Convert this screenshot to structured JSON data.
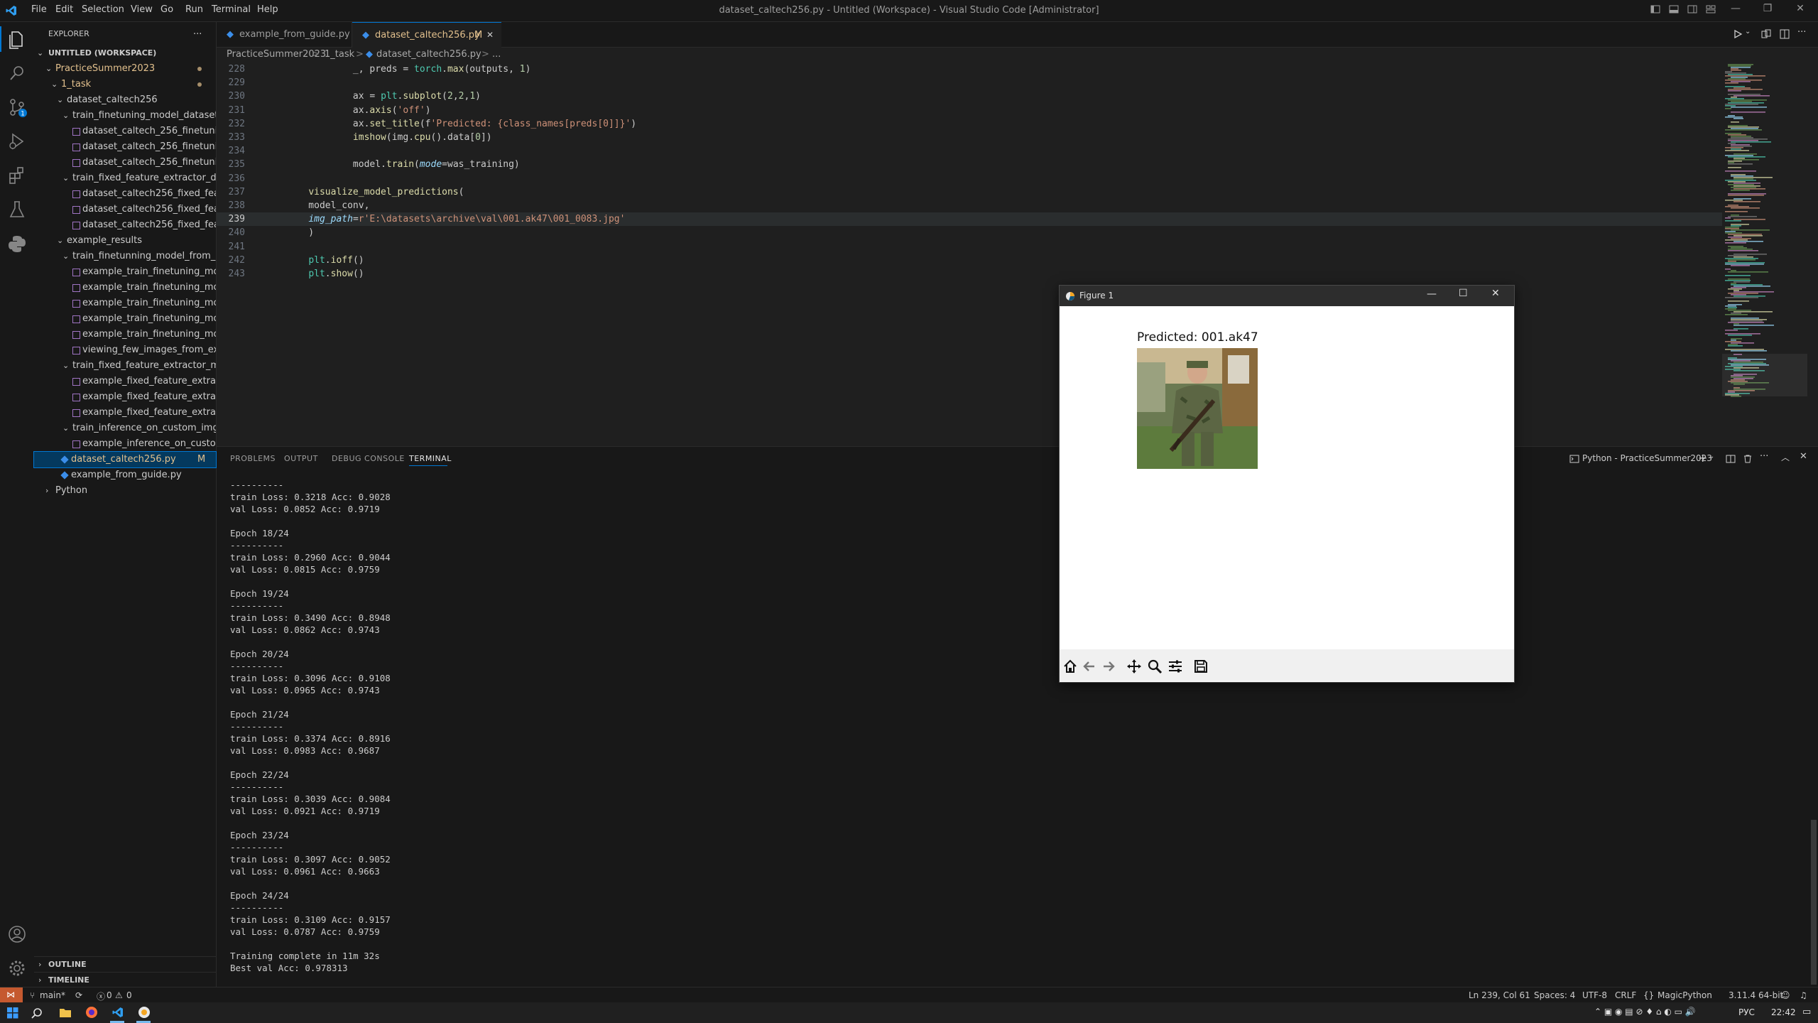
{
  "titlebar": {
    "menu": [
      "File",
      "Edit",
      "Selection",
      "View",
      "Go",
      "Run",
      "Terminal",
      "Help"
    ],
    "title": "dataset_caltech256.py - Untitled (Workspace) - Visual Studio Code [Administrator]"
  },
  "sidebar": {
    "header": "EXPLORER",
    "more": "...",
    "workspace": "UNTITLED (WORKSPACE)",
    "tree": [
      {
        "label": "PracticeSummer2023",
        "indent": 1,
        "type": "folder-open",
        "dot": true
      },
      {
        "label": "1_task",
        "indent": 2,
        "type": "folder-open",
        "dot": true
      },
      {
        "label": "dataset_caltech256",
        "indent": 3,
        "type": "folder-open"
      },
      {
        "label": "train_finetuning_model_dataset_...",
        "indent": 4,
        "type": "folder-open"
      },
      {
        "label": "dataset_caltech_256_finetunin...",
        "indent": 5,
        "type": "image"
      },
      {
        "label": "dataset_caltech_256_finetunin...",
        "indent": 5,
        "type": "image"
      },
      {
        "label": "dataset_caltech_256_finetunin...",
        "indent": 5,
        "type": "image"
      },
      {
        "label": "train_fixed_feature_extractor_dat...",
        "indent": 4,
        "type": "folder-open"
      },
      {
        "label": "dataset_caltech256_fixed_featu...",
        "indent": 5,
        "type": "image"
      },
      {
        "label": "dataset_caltech256_fixed_featu...",
        "indent": 5,
        "type": "image"
      },
      {
        "label": "dataset_caltech256_fixed_featu...",
        "indent": 5,
        "type": "image"
      },
      {
        "label": "example_results",
        "indent": 3,
        "type": "folder-open"
      },
      {
        "label": "train_finetunning_model_from_e...",
        "indent": 4,
        "type": "folder-open"
      },
      {
        "label": "example_train_finetuning_mod...",
        "indent": 5,
        "type": "image"
      },
      {
        "label": "example_train_finetuning_mod...",
        "indent": 5,
        "type": "image"
      },
      {
        "label": "example_train_finetuning_mod...",
        "indent": 5,
        "type": "image"
      },
      {
        "label": "example_train_finetuning_mod...",
        "indent": 5,
        "type": "image"
      },
      {
        "label": "example_train_finetuning_mod...",
        "indent": 5,
        "type": "image"
      },
      {
        "label": "viewing_few_images_from_exa...",
        "indent": 5,
        "type": "image"
      },
      {
        "label": "train_fixed_feature_extractor_mo...",
        "indent": 4,
        "type": "folder-open"
      },
      {
        "label": "example_fixed_feature_extracto...",
        "indent": 5,
        "type": "image"
      },
      {
        "label": "example_fixed_feature_extracto...",
        "indent": 5,
        "type": "image"
      },
      {
        "label": "example_fixed_feature_extracto...",
        "indent": 5,
        "type": "image"
      },
      {
        "label": "train_inference_on_custom_imgs...",
        "indent": 4,
        "type": "folder-open"
      },
      {
        "label": "example_inference_on_custom_...",
        "indent": 5,
        "type": "image"
      },
      {
        "label": "dataset_caltech256.py",
        "indent": 3,
        "type": "python",
        "selected": true,
        "badge": "M"
      },
      {
        "label": "example_from_guide.py",
        "indent": 3,
        "type": "python"
      },
      {
        "label": "Python",
        "indent": 1,
        "type": "folder-closed"
      }
    ],
    "outline": "OUTLINE",
    "timeline": "TIMELINE"
  },
  "tabs": [
    {
      "label": "example_from_guide.py",
      "active": false
    },
    {
      "label": "dataset_caltech256.py",
      "active": true,
      "badge": "M",
      "close": "✕"
    }
  ],
  "breadcrumb": [
    "PracticeSummer2023",
    "1_task",
    "dataset_caltech256.py",
    "..."
  ],
  "breadcrumb_sep": ">",
  "code": [
    {
      "n": "228",
      "text": "            _, preds = torch.max(outputs, 1)"
    },
    {
      "n": "229",
      "text": ""
    },
    {
      "n": "230",
      "text": "            ax = plt.subplot(2,2,1)"
    },
    {
      "n": "231",
      "text": "            ax.axis('off')"
    },
    {
      "n": "232",
      "text": "            ax.set_title(f'Predicted: {class_names[preds[0]]}')"
    },
    {
      "n": "233",
      "text": "            imshow(img.cpu().data[0])"
    },
    {
      "n": "234",
      "text": ""
    },
    {
      "n": "235",
      "text": "            model.train(mode=was_training)"
    },
    {
      "n": "236",
      "text": ""
    },
    {
      "n": "237",
      "text": "    visualize_model_predictions("
    },
    {
      "n": "238",
      "text": "    model_conv,"
    },
    {
      "n": "239",
      "text": "    img_path=r'E:\\datasets\\archive\\val\\001.ak47\\001_0083.jpg'"
    },
    {
      "n": "240",
      "text": "    )"
    },
    {
      "n": "241",
      "text": ""
    },
    {
      "n": "242",
      "text": "    plt.ioff()"
    },
    {
      "n": "243",
      "text": "    plt.show()"
    }
  ],
  "panel": {
    "tabs": [
      "PROBLEMS",
      "OUTPUT",
      "DEBUG CONSOLE",
      "TERMINAL"
    ],
    "active_tab": "TERMINAL",
    "terminal_name": "Python - PracticeSummer2023",
    "terminal_lines": [
      "----------",
      "train Loss: 0.3218 Acc: 0.9028",
      "val Loss: 0.0852 Acc: 0.9719",
      "",
      "Epoch 18/24",
      "----------",
      "train Loss: 0.2960 Acc: 0.9044",
      "val Loss: 0.0815 Acc: 0.9759",
      "",
      "Epoch 19/24",
      "----------",
      "train Loss: 0.3490 Acc: 0.8948",
      "val Loss: 0.0862 Acc: 0.9743",
      "",
      "Epoch 20/24",
      "----------",
      "train Loss: 0.3096 Acc: 0.9108",
      "val Loss: 0.0965 Acc: 0.9743",
      "",
      "Epoch 21/24",
      "----------",
      "train Loss: 0.3374 Acc: 0.8916",
      "val Loss: 0.0983 Acc: 0.9687",
      "",
      "Epoch 22/24",
      "----------",
      "train Loss: 0.3039 Acc: 0.9084",
      "val Loss: 0.0921 Acc: 0.9719",
      "",
      "Epoch 23/24",
      "----------",
      "train Loss: 0.3097 Acc: 0.9052",
      "val Loss: 0.0961 Acc: 0.9663",
      "",
      "Epoch 24/24",
      "----------",
      "train Loss: 0.3109 Acc: 0.9157",
      "val Loss: 0.0787 Acc: 0.9759",
      "",
      "Training complete in 11m 32s",
      "Best val Acc: 0.978313"
    ]
  },
  "figure": {
    "window_title": "Figure 1",
    "plot_title": "Predicted: 001.ak47",
    "toolbar": [
      "home-icon",
      "back-icon",
      "forward-icon",
      "pan-icon",
      "zoom-icon",
      "configure-icon",
      "save-icon"
    ]
  },
  "statusbar": {
    "branch": "main*",
    "errors": "0",
    "warnings": "0",
    "position": "Ln 239, Col 61",
    "spaces": "Spaces: 4",
    "encoding": "UTF-8",
    "eol": "CRLF",
    "language": "MagicPython",
    "interpreter": "3.11.4 64-bit"
  },
  "taskbar": {
    "lang": "РУС",
    "time": "22:42"
  },
  "colors": {
    "accent": "#0078d4",
    "modified": "#e2c08d",
    "python_icon": "#3b8eea"
  }
}
